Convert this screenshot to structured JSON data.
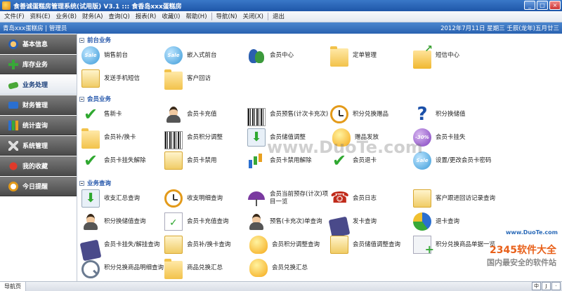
{
  "window": {
    "title": "食善诚蛋糕房管理系统(试用版) V3.1   :::  食香岛xxx蛋糕房",
    "btn_min": "_",
    "btn_max": "□",
    "btn_close": "×"
  },
  "menu": [
    "文件(F)",
    "资料(E)",
    "业务(B)",
    "财务(A)",
    "查询(Q)",
    "报表(R)",
    "收藏(I)",
    "帮助(H)",
    "导航(N)",
    "关闭(X)",
    "退出"
  ],
  "infobar": {
    "left": "青岛xxx蛋糕房 | 管理员",
    "right": "2012年7月11日   星期三   壬辰(龙年)五月廿三"
  },
  "sidebar": [
    {
      "label": "基本信息",
      "icon": "people-icon",
      "active": false
    },
    {
      "label": "库存业务",
      "icon": "plus-icon",
      "active": false
    },
    {
      "label": "业务处理",
      "icon": "tag-icon",
      "active": true
    },
    {
      "label": "财务管理",
      "icon": "wallet-icon",
      "active": false
    },
    {
      "label": "统计查询",
      "icon": "bar-chart-icon",
      "active": false
    },
    {
      "label": "系统管理",
      "icon": "tools-icon",
      "active": false
    },
    {
      "label": "我的收藏",
      "icon": "star-icon",
      "active": false
    },
    {
      "label": "今日提醒",
      "icon": "clock-icon",
      "active": false
    }
  ],
  "sections": [
    {
      "title": "前台业务",
      "items": [
        {
          "label": "销售前台",
          "icon": "sale-badge-icon"
        },
        {
          "label": "嵌入式前台",
          "icon": "sale-badge-icon"
        },
        {
          "label": "会员中心",
          "icon": "members-icon"
        },
        {
          "label": "定单管理",
          "icon": "folder-icon"
        },
        {
          "label": "短信中心",
          "icon": "mail-send-icon"
        },
        {
          "label": "发送手机短信",
          "icon": "document-icon"
        },
        {
          "label": "客户回访",
          "icon": "folder-icon"
        }
      ]
    },
    {
      "title": "会员业务",
      "items": [
        {
          "label": "售新卡",
          "icon": "check-icon"
        },
        {
          "label": "会员卡充值",
          "icon": "person-icon"
        },
        {
          "label": "会员预售(计次卡充次)",
          "icon": "barcode-icon"
        },
        {
          "label": "积分兑换赠品",
          "icon": "clock-icon"
        },
        {
          "label": "积分换储值",
          "icon": "question-icon"
        },
        {
          "label": "会员补/换卡",
          "icon": "folder-icon"
        },
        {
          "label": "会员积分调整",
          "icon": "barcode-icon"
        },
        {
          "label": "会员储值调整",
          "icon": "download-icon"
        },
        {
          "label": "赠品发放",
          "icon": "bulb-icon"
        },
        {
          "label": "会员卡挂失",
          "icon": "discount-badge-icon"
        },
        {
          "label": "会员卡挂失解除",
          "icon": "check-icon"
        },
        {
          "label": "会员卡禁用",
          "icon": "document-icon"
        },
        {
          "label": "会员卡禁用解除",
          "icon": "bar-chart-icon"
        },
        {
          "label": "会员退卡",
          "icon": "check-icon"
        },
        {
          "label": "设置/更改会员卡密码",
          "icon": "sale-badge-icon"
        }
      ]
    },
    {
      "title": "业务查询",
      "items": [
        {
          "label": "收支汇总查询",
          "icon": "download-icon"
        },
        {
          "label": "收支明细查询",
          "icon": "clock-icon"
        },
        {
          "label": "会员当前预存(计次)项目一览",
          "icon": "umbrella-icon"
        },
        {
          "label": "会员日志",
          "icon": "phone-icon"
        },
        {
          "label": "客户跟进回访记录查询",
          "icon": "document-icon"
        },
        {
          "label": "积分换储值查询",
          "icon": "person-icon"
        },
        {
          "label": "会员卡充值查询",
          "icon": "document-check-icon"
        },
        {
          "label": "预售(卡充次)单查询",
          "icon": "person-icon"
        },
        {
          "label": "发卡查询",
          "icon": "tag-icon"
        },
        {
          "label": "退卡查询",
          "icon": "pie-icon"
        },
        {
          "label": "会员卡挂失/解挂查询",
          "icon": "tag-icon"
        },
        {
          "label": "会员补/换卡查询",
          "icon": "document-icon"
        },
        {
          "label": "会员积分调整查询",
          "icon": "bulb-icon"
        },
        {
          "label": "会员储值调整查询",
          "icon": "document-icon"
        },
        {
          "label": "积分兑换商品单据一览",
          "icon": "document-plus-icon"
        },
        {
          "label": "积分兑换商品明细查询",
          "icon": "search-icon"
        },
        {
          "label": "商品兑换汇总",
          "icon": "folder-icon"
        },
        {
          "label": "会员兑换汇总",
          "icon": "bulb-icon"
        }
      ]
    }
  ],
  "statusbar": {
    "tab": "导航页",
    "ime": [
      "中",
      "J",
      "·"
    ]
  },
  "watermarks": {
    "duote": "www.DuoTe.com",
    "brand": "2345软件大全",
    "slogan": "国内最安全的软件站",
    "url": "www.DuoTe.com"
  }
}
